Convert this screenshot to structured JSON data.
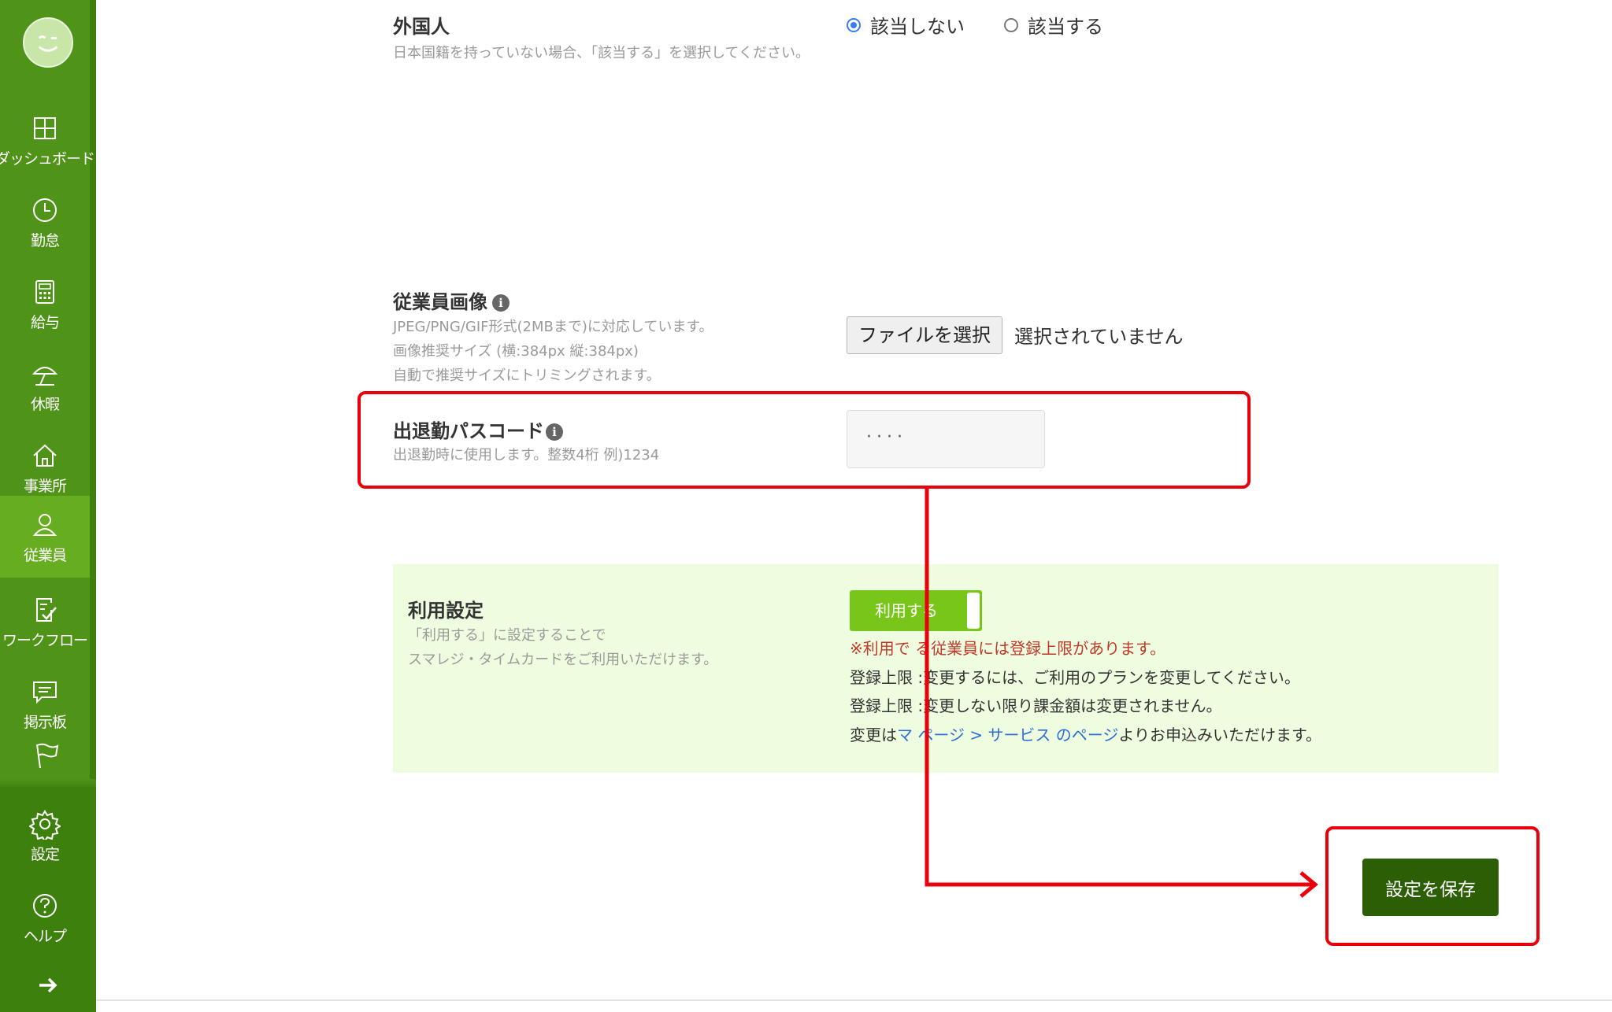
{
  "sidebar": {
    "items": [
      {
        "label": "ダッシュボード",
        "icon": "dashboard-icon"
      },
      {
        "label": "勤怠",
        "icon": "clock-icon"
      },
      {
        "label": "給与",
        "icon": "calculator-icon"
      },
      {
        "label": "休暇",
        "icon": "parasol-icon"
      },
      {
        "label": "事業所",
        "icon": "home-icon"
      },
      {
        "label": "従業員",
        "icon": "person-icon"
      },
      {
        "label": "ワークフロー",
        "icon": "checklist-icon"
      },
      {
        "label": "掲示板",
        "icon": "chat-icon"
      },
      {
        "label": "",
        "icon": "flag-icon"
      },
      {
        "label": "設定",
        "icon": "gear-icon"
      },
      {
        "label": "ヘルプ",
        "icon": "help-icon"
      }
    ],
    "active_item": "従業員",
    "accent_color": "#4f9418"
  },
  "foreigner": {
    "title": "外国人",
    "help": "日本国籍を持っていない場合、「該当する」を選択してください。",
    "options": [
      "該当しない",
      "該当する"
    ],
    "selected": "該当しない"
  },
  "employee_image": {
    "title": "従業員画像",
    "help_lines": [
      "JPEG/PNG/GIF形式(2MBまで)に対応しています。",
      "画像推奨サイズ (横:384px 縦:384px)",
      "自動で推奨サイズにトリミングされます。"
    ],
    "button_label": "ファイルを選択",
    "status": "選択されていません"
  },
  "passcode": {
    "title": "出退勤パスコード",
    "help": "出退勤時に使用します。整数4桁 例)1234",
    "masked_value": "····"
  },
  "usage": {
    "title": "利用設定",
    "help_lines": [
      "「利用する」に設定することで",
      "スマレジ・タイムカードをご利用いただけます。"
    ],
    "toggle_label": "利用する",
    "warning": "※利用で  る従業員には登録上限があります。",
    "note1": "登録上限  :変更するには、ご利用のプランを変更してください。",
    "note2": "登録上限  :変更しない限り課金額は変更されません。",
    "note3_prefix": "変更は",
    "note3_link": "マ  ページ > サービス のページ",
    "note3_suffix": "よりお申込みいただけます。"
  },
  "save_button": {
    "label": "設定を保存",
    "color": "#2b5e05"
  },
  "annotation_color": "#e8000b"
}
